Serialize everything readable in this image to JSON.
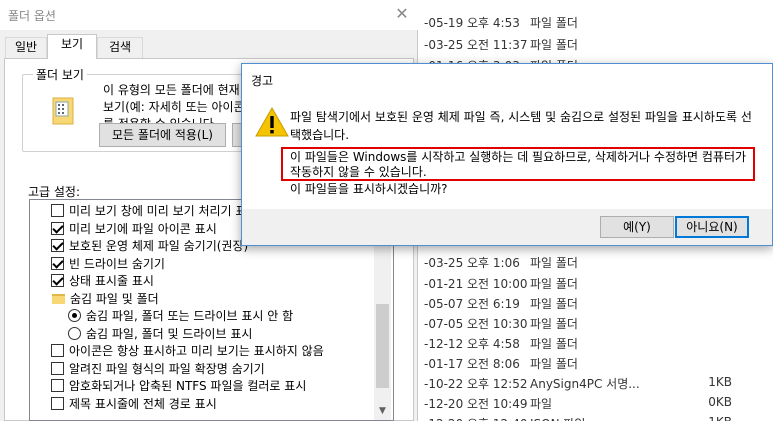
{
  "explorer": {
    "rows": [
      {
        "date": "-05-19 오후 4:53",
        "type": "파일 폴더",
        "size": ""
      },
      {
        "date": "-03-25 오전 11:37",
        "type": "파일 폴더",
        "size": ""
      },
      {
        "date": "-01-16 오후 3:03",
        "type": "파일 폴더",
        "size": ""
      },
      {
        "date": "-03-25 오후 1:06",
        "type": "파일 폴더",
        "size": ""
      },
      {
        "date": "-01-21 오전 10:00",
        "type": "파일 폴더",
        "size": ""
      },
      {
        "date": "-05-07 오전 6:19",
        "type": "파일 폴더",
        "size": ""
      },
      {
        "date": "-07-05 오전 10:30",
        "type": "파일 폴더",
        "size": ""
      },
      {
        "date": "-12-12 오후 4:58",
        "type": "파일 폴더",
        "size": ""
      },
      {
        "date": "-01-17 오전 8:06",
        "type": "파일 폴더",
        "size": ""
      },
      {
        "date": "-10-22 오후 12:52",
        "type": "AnySign4PC 서명...",
        "size": "1KB"
      },
      {
        "date": "-12-20 오전 10:49",
        "type": "파일",
        "size": "0KB"
      },
      {
        "date": "-12-20 오후 12:40",
        "type": "JSON 파일",
        "size": "1KB"
      }
    ]
  },
  "folder_options": {
    "title": "폴더 옵션",
    "tabs": [
      "일반",
      "보기",
      "검색"
    ],
    "group_label": "폴더 보기",
    "group_text": "이 유형의 모든 폴더에 현재 보기(예: 자세히 또는 아이콘)를 적용할 수 있습니다.",
    "apply_all_button": "모든 폴더에 적용(L)",
    "advanced_label": "고급 설정:",
    "advanced_items": [
      {
        "kind": "checkbox",
        "checked": false,
        "label": "미리 보기 창에 미리 보기 처리기 표시"
      },
      {
        "kind": "checkbox",
        "checked": true,
        "label": "미리 보기에 파일 아이콘 표시"
      },
      {
        "kind": "checkbox",
        "checked": true,
        "label": "보호된 운영 체제 파일 숨기기(권장)"
      },
      {
        "kind": "checkbox",
        "checked": true,
        "label": "빈 드라이브 숨기기"
      },
      {
        "kind": "checkbox",
        "checked": true,
        "label": "상태 표시줄 표시"
      },
      {
        "kind": "folder",
        "checked": false,
        "label": "숨김 파일 및 폴더"
      },
      {
        "kind": "radio",
        "checked": true,
        "label": "숨김 파일, 폴더 또는 드라이브 표시 안 함"
      },
      {
        "kind": "radio",
        "checked": false,
        "label": "숨김 파일, 폴더 및 드라이브 표시"
      },
      {
        "kind": "checkbox",
        "checked": false,
        "label": "아이콘은 항상 표시하고 미리 보기는 표시하지 않음"
      },
      {
        "kind": "checkbox",
        "checked": false,
        "label": "알려진 파일 형식의 파일 확장명 숨기기"
      },
      {
        "kind": "checkbox",
        "checked": false,
        "label": "암호화되거나 압축된 NTFS 파일을 컬러로 표시"
      },
      {
        "kind": "checkbox",
        "checked": false,
        "label": "제목 표시줄에 전체 경로 표시"
      }
    ]
  },
  "warning_dialog": {
    "title": "경고",
    "message_line1": "파일 탐색기에서 보호된 운영 체제 파일 즉, 시스템 및 숨김으로 설정된 파일을 표시하도록 선택했습니다.",
    "message_highlight": "이 파일들은 Windows를 시작하고 실행하는 데 필요하므로, 삭제하거나 수정하면 컴퓨터가 작동하지 않을 수 있습니다.",
    "question": "이 파일들을 표시하시겠습니까?",
    "yes_button": "예(Y)",
    "no_button": "아니요(N)"
  },
  "colors": {
    "highlight_border": "#e00000",
    "warning_icon": "#f5c400",
    "default_button_border": "#0078d7"
  }
}
